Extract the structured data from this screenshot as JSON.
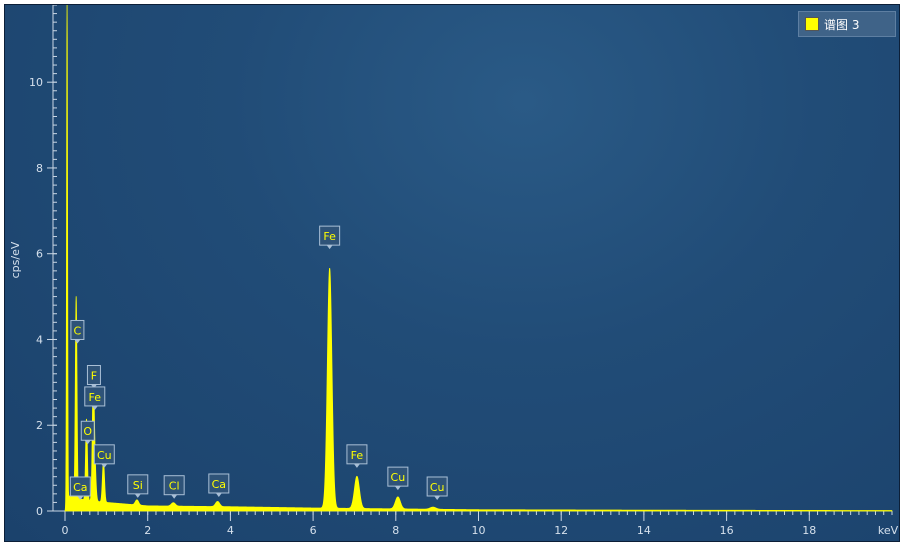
{
  "legend": {
    "label": "谱图 3",
    "color": "#ffff00"
  },
  "chart_data": {
    "type": "line",
    "xlabel": "keV",
    "ylabel": "cps/eV",
    "xlim": [
      0,
      20
    ],
    "ylim": [
      0,
      11.8
    ],
    "x_ticks": [
      0,
      2,
      4,
      6,
      8,
      10,
      12,
      14,
      16,
      18
    ],
    "y_ticks": [
      0,
      2,
      4,
      6,
      8,
      10
    ],
    "grid": false,
    "legend_position": "top-right",
    "series": [
      {
        "name": "谱图 3",
        "color": "#ffff00",
        "peaks": [
          {
            "x": 0.05,
            "y": 11.8,
            "w": 0.012
          },
          {
            "x": 0.27,
            "y": 4.7,
            "w": 0.02
          },
          {
            "x": 0.52,
            "y": 1.9,
            "w": 0.022
          },
          {
            "x": 0.68,
            "y": 2.1,
            "w": 0.022
          },
          {
            "x": 0.71,
            "y": 1.2,
            "w": 0.03
          },
          {
            "x": 0.93,
            "y": 0.95,
            "w": 0.025
          },
          {
            "x": 1.74,
            "y": 0.12,
            "w": 0.04
          },
          {
            "x": 2.62,
            "y": 0.08,
            "w": 0.05
          },
          {
            "x": 3.69,
            "y": 0.12,
            "w": 0.05
          },
          {
            "x": 6.4,
            "y": 5.6,
            "w": 0.055
          },
          {
            "x": 7.06,
            "y": 0.75,
            "w": 0.06
          },
          {
            "x": 8.05,
            "y": 0.28,
            "w": 0.06
          },
          {
            "x": 8.9,
            "y": 0.05,
            "w": 0.07
          }
        ],
        "background": [
          [
            0.0,
            0.0
          ],
          [
            0.1,
            0.35
          ],
          [
            0.5,
            0.25
          ],
          [
            1.0,
            0.2
          ],
          [
            2.0,
            0.12
          ],
          [
            4.0,
            0.1
          ],
          [
            6.0,
            0.07
          ],
          [
            8.0,
            0.05
          ],
          [
            10.0,
            0.03
          ],
          [
            14.0,
            0.02
          ],
          [
            20.0,
            0.01
          ]
        ]
      }
    ],
    "annotations": [
      {
        "label": "C",
        "x": 0.3,
        "y": 4.0
      },
      {
        "label": "F",
        "x": 0.7,
        "y": 2.95
      },
      {
        "label": "Fe",
        "x": 0.72,
        "y": 2.45
      },
      {
        "label": "O",
        "x": 0.55,
        "y": 1.65
      },
      {
        "label": "Cu",
        "x": 0.95,
        "y": 1.1
      },
      {
        "label": "Ca",
        "x": 0.37,
        "y": 0.35
      },
      {
        "label": "Si",
        "x": 1.76,
        "y": 0.4
      },
      {
        "label": "Cl",
        "x": 2.64,
        "y": 0.38
      },
      {
        "label": "Ca",
        "x": 3.72,
        "y": 0.42
      },
      {
        "label": "Fe",
        "x": 6.4,
        "y": 6.2
      },
      {
        "label": "Fe",
        "x": 7.06,
        "y": 1.1
      },
      {
        "label": "Cu",
        "x": 8.05,
        "y": 0.58
      },
      {
        "label": "Cu",
        "x": 9.0,
        "y": 0.35
      }
    ]
  }
}
